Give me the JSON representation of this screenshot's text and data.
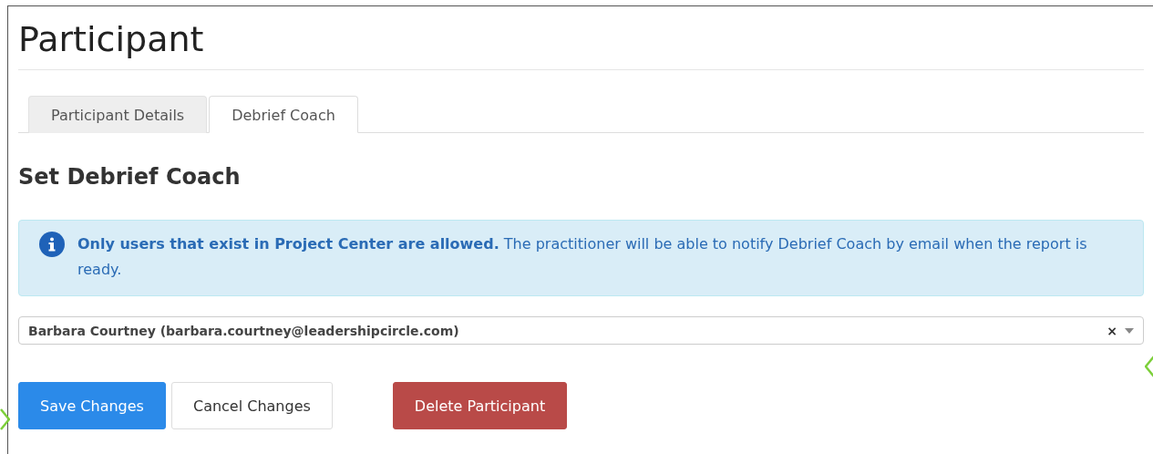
{
  "page": {
    "title": "Participant"
  },
  "tabs": [
    {
      "label": "Participant Details",
      "selected": false
    },
    {
      "label": "Debrief Coach",
      "selected": true
    }
  ],
  "section": {
    "heading": "Set Debrief Coach"
  },
  "alert": {
    "text": "**Only users that exist in Project Center are allowed.** The practitioner will be able to notify Debrief Coach by email when the report is ready."
  },
  "coach_select": {
    "value": "Barbara Courtney (barbara.courtney@leadershipcircle.com)",
    "clear": "×"
  },
  "buttons": [
    {
      "label": "Save Changes",
      "kind": "primary"
    },
    {
      "label": "Cancel Changes",
      "kind": "default"
    },
    {
      "label": "Delete Participant",
      "kind": "danger"
    }
  ]
}
